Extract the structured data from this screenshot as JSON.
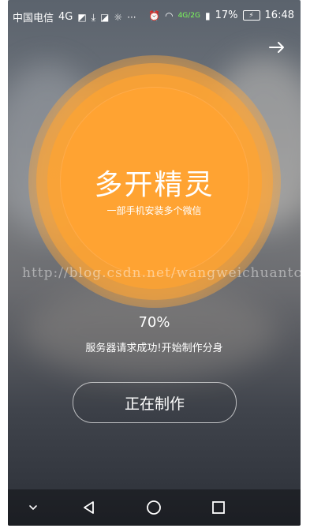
{
  "status_bar": {
    "carrier": "中国电信",
    "network": "4G",
    "signal_label": "4G/2G",
    "battery_percent": "17%",
    "time": "16:48"
  },
  "header": {
    "next_icon": "arrow-right-icon"
  },
  "hero": {
    "title": "多开精灵",
    "subtitle": "一部手机安装多个微信"
  },
  "watermark": "http://blog.csdn.net/wangweichuantcy",
  "progress": {
    "percent_text": "70%",
    "percent_value": 0.7,
    "message": "服务器请求成功!开始制作分身"
  },
  "action": {
    "button_label": "正在制作"
  },
  "nav": {
    "items": [
      "chevron-down-icon",
      "back-icon",
      "home-icon",
      "recent-apps-icon"
    ]
  },
  "colors": {
    "accent": "#ffa332"
  }
}
